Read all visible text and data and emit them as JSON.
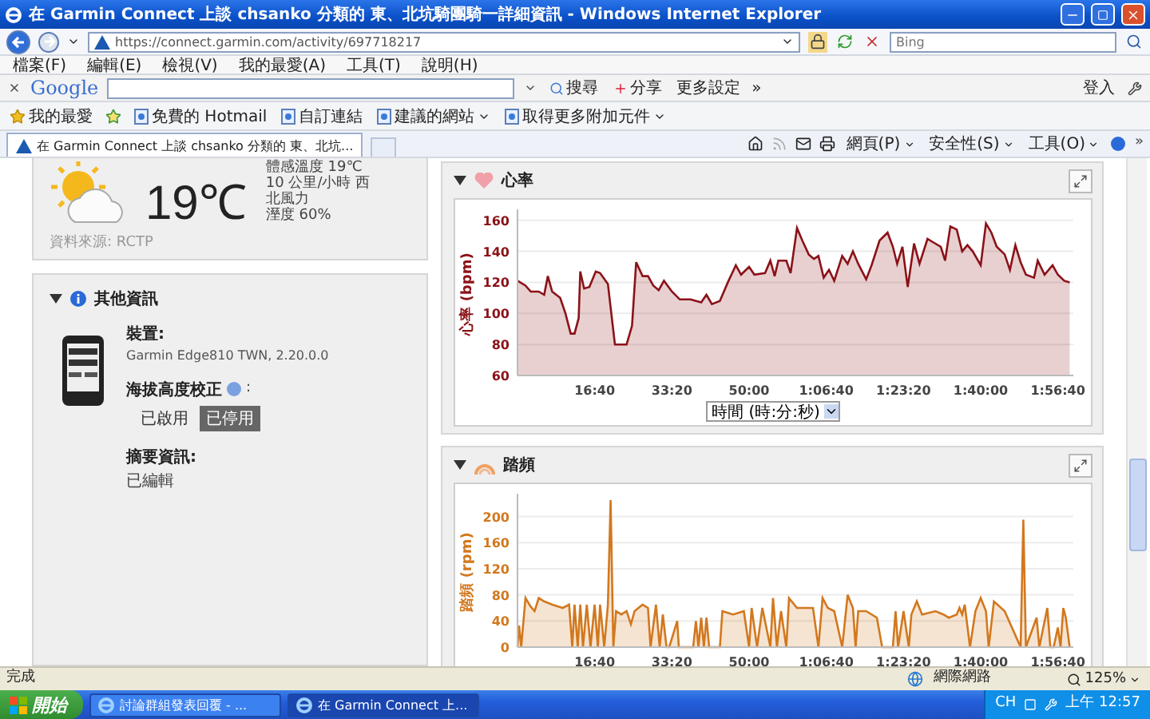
{
  "window": {
    "title": "在 Garmin Connect 上談 chsanko 分類的 東、北坑騎團騎一詳細資訊 - Windows Internet Explorer"
  },
  "address_bar": {
    "url": "https://connect.garmin.com/activity/697718217",
    "search_placeholder": "Bing"
  },
  "menu": [
    "檔案(F)",
    "編輯(E)",
    "檢視(V)",
    "我的最愛(A)",
    "工具(T)",
    "說明(H)"
  ],
  "google_toolbar": {
    "logo": "Google",
    "search_button": "搜尋",
    "share_button": "分享",
    "more_button": "更多設定",
    "more_chevron": "»",
    "sign_in": "登入"
  },
  "favorites_bar": {
    "label": "我的最愛",
    "items": [
      {
        "label": "免費的 Hotmail",
        "dropdown": false
      },
      {
        "label": "自訂連結",
        "dropdown": false
      },
      {
        "label": "建議的網站",
        "dropdown": true
      },
      {
        "label": "取得更多附加元件",
        "dropdown": true
      }
    ]
  },
  "tabs": [
    {
      "title": "在 Garmin Connect 上談 chsanko 分類的 東、北坑...",
      "selected": true
    }
  ],
  "command_bar": {
    "menus": [
      "網頁(P)",
      "安全性(S)",
      "工具(O)"
    ],
    "overflow": "»"
  },
  "weather": {
    "temperature": "19℃",
    "feels_like": "體感溫度 19℃",
    "wind": "10 公里/小時 西北風力",
    "humidity": "溼度 60%",
    "source": "資料來源: RCTP"
  },
  "other_info": {
    "title": "其他資訊",
    "expanded": true,
    "device_label": "裝置:",
    "device": "Garmin Edge810 TWN, 2.20.0.0",
    "elevation_label": "海拔高度校正",
    "elevation_colon": ":",
    "elevation_options": [
      {
        "label": "已啟用",
        "selected": false
      },
      {
        "label": "已停用",
        "selected": true
      }
    ],
    "summary_label": "摘要資訊:",
    "summary": "已編輯"
  },
  "heart_rate": {
    "title": "心率",
    "expanded": true,
    "axis_select": "時間 (時:分:秒)",
    "chart_data": {
      "type": "area",
      "grid": true,
      "ylabel": "心率 (bpm)",
      "xlim": [
        0,
        7200
      ],
      "ylim": [
        60,
        165
      ],
      "yticks": [
        60,
        80,
        100,
        120,
        140,
        160
      ],
      "xticks": [
        {
          "value": 1000,
          "label": "16:40"
        },
        {
          "value": 2000,
          "label": "33:20"
        },
        {
          "value": 3000,
          "label": "50:00"
        },
        {
          "value": 4000,
          "label": "1:06:40"
        },
        {
          "value": 5000,
          "label": "1:23:20"
        },
        {
          "value": 6000,
          "label": "1:40:00"
        },
        {
          "value": 7000,
          "label": "1:56:40"
        }
      ],
      "x": [
        0,
        103,
        172,
        276,
        345,
        393,
        448,
        552,
        621,
        690,
        738,
        793,
        814,
        862,
        931,
        1014,
        1069,
        1172,
        1262,
        1414,
        1483,
        1538,
        1621,
        1690,
        1759,
        1828,
        1897,
        2000,
        2103,
        2241,
        2379,
        2448,
        2517,
        2621,
        2724,
        2828,
        2897,
        3000,
        3069,
        3207,
        3276,
        3331,
        3379,
        3483,
        3538,
        3621,
        3690,
        3772,
        3841,
        3897,
        3966,
        4034,
        4103,
        4207,
        4276,
        4345,
        4414,
        4517,
        4586,
        4690,
        4793,
        4862,
        4917,
        4986,
        5055,
        5138,
        5207,
        5310,
        5379,
        5483,
        5538,
        5607,
        5690,
        5759,
        5828,
        5897,
        6000,
        6069,
        6138,
        6207,
        6310,
        6379,
        6448,
        6517,
        6586,
        6690,
        6738,
        6828,
        6931,
        7000,
        7083,
        7152
      ],
      "series": [
        {
          "color": "#8b1218",
          "values": [
            121,
            118,
            114,
            114,
            112,
            124,
            114,
            110,
            100,
            87,
            87,
            97,
            127,
            116,
            117,
            127,
            126,
            119,
            80,
            80,
            92,
            133,
            124,
            124,
            118,
            115,
            121,
            114,
            109,
            109,
            107,
            112,
            106,
            108,
            120,
            131,
            125,
            130,
            125,
            126,
            134,
            124,
            134,
            134,
            126,
            155,
            147,
            138,
            135,
            137,
            123,
            128,
            121,
            137,
            132,
            140,
            132,
            122,
            131,
            147,
            152,
            143,
            132,
            143,
            117,
            145,
            132,
            148,
            146,
            143,
            134,
            156,
            154,
            140,
            144,
            140,
            131,
            158,
            152,
            143,
            138,
            128,
            144,
            133,
            125,
            123,
            134,
            125,
            131,
            125,
            121,
            120
          ]
        }
      ]
    }
  },
  "cadence": {
    "title": "踏頻",
    "expanded": true,
    "chart_data": {
      "type": "area",
      "grid": true,
      "ylabel": "踏頻 (rpm)",
      "xlim": [
        0,
        7200
      ],
      "ylim": [
        0,
        230
      ],
      "yticks": [
        0,
        40,
        80,
        120,
        160,
        200
      ],
      "xticks": [
        {
          "value": 1000,
          "label": "16:40"
        },
        {
          "value": 2000,
          "label": "33:20"
        },
        {
          "value": 3000,
          "label": "50:00"
        },
        {
          "value": 4000,
          "label": "1:06:40"
        },
        {
          "value": 5000,
          "label": "1:23:20"
        },
        {
          "value": 6000,
          "label": "1:40:00"
        },
        {
          "value": 7000,
          "label": "1:56:40"
        }
      ],
      "x": [
        0,
        21,
        48,
        103,
        172,
        221,
        276,
        345,
        448,
        586,
        669,
        710,
        738,
        779,
        814,
        848,
        897,
        945,
        1000,
        1041,
        1069,
        1124,
        1172,
        1207,
        1241,
        1276,
        1345,
        1414,
        1469,
        1517,
        1621,
        1690,
        1724,
        1793,
        1841,
        1883,
        1931,
        1966,
        2069,
        2090,
        2276,
        2310,
        2345,
        2379,
        2414,
        2448,
        2483,
        2621,
        2655,
        2793,
        2931,
        3000,
        3034,
        3103,
        3172,
        3276,
        3310,
        3359,
        3414,
        3483,
        3517,
        3621,
        3828,
        3897,
        3952,
        4021,
        4103,
        4207,
        4276,
        4345,
        4379,
        4414,
        4517,
        4655,
        4724,
        4759,
        4862,
        4897,
        4931,
        5000,
        5069,
        5103,
        5172,
        5241,
        5414,
        5517,
        5586,
        5690,
        5724,
        5759,
        5793,
        5862,
        5931,
        6000,
        6069,
        6103,
        6172,
        6310,
        6517,
        6552,
        6586,
        6724,
        6759,
        6862,
        6903,
        6945,
        7000,
        7034,
        7069,
        7103,
        7152
      ],
      "series": [
        {
          "color": "#d2781e",
          "values": [
            0,
            33,
            0,
            75,
            62,
            55,
            75,
            70,
            65,
            60,
            65,
            0,
            65,
            0,
            65,
            0,
            65,
            0,
            65,
            0,
            65,
            0,
            65,
            225,
            0,
            55,
            50,
            55,
            35,
            55,
            65,
            60,
            0,
            65,
            0,
            50,
            0,
            0,
            40,
            0,
            0,
            40,
            0,
            45,
            0,
            45,
            0,
            0,
            55,
            50,
            55,
            0,
            60,
            0,
            60,
            0,
            75,
            0,
            55,
            0,
            75,
            60,
            60,
            0,
            75,
            60,
            55,
            0,
            80,
            60,
            0,
            55,
            55,
            45,
            0,
            0,
            0,
            55,
            0,
            55,
            0,
            50,
            70,
            50,
            55,
            50,
            45,
            50,
            60,
            50,
            65,
            0,
            55,
            75,
            55,
            0,
            70,
            55,
            0,
            195,
            0,
            45,
            0,
            60,
            0,
            0,
            30,
            0,
            60,
            45,
            0
          ]
        }
      ]
    }
  },
  "status_bar": {
    "text": "完成",
    "zone": "網際網路",
    "zoom": "125%"
  },
  "taskbar": {
    "start": "開始",
    "tasks": [
      {
        "label": "討論群組發表回覆 - ...",
        "selected": false
      },
      {
        "label": "在 Garmin Connect 上...",
        "selected": true
      }
    ],
    "language": "CH",
    "clock": "上午 12:57"
  }
}
